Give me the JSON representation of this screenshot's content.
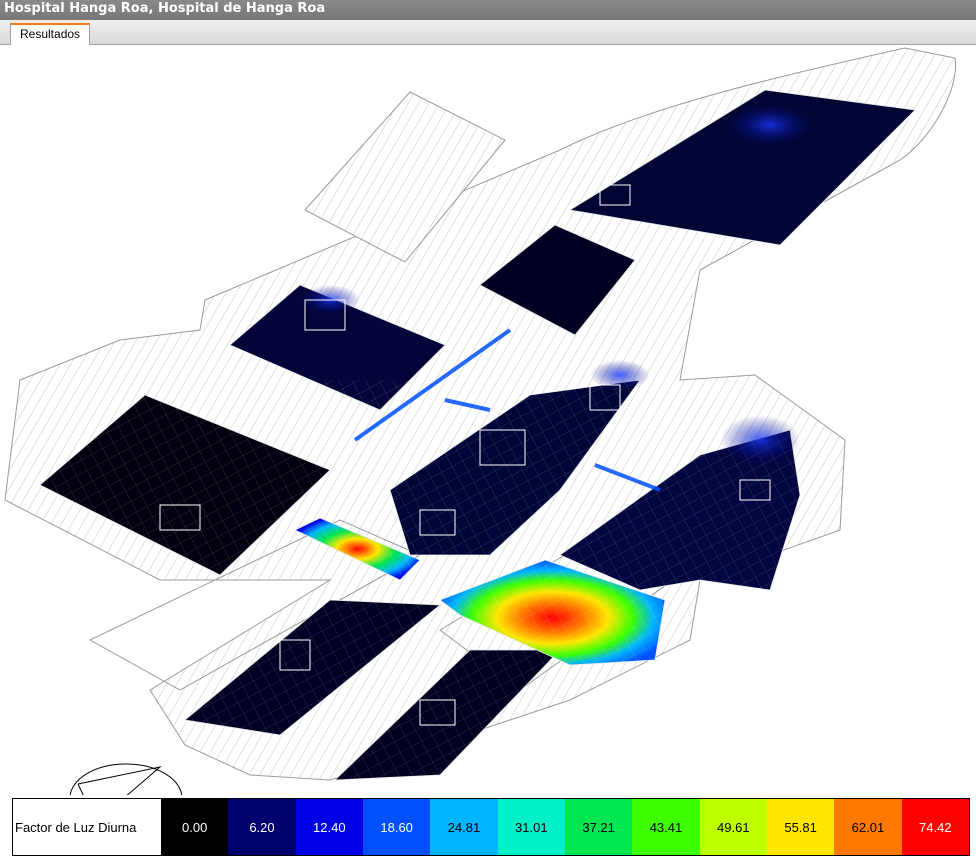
{
  "window": {
    "title": "Hospital Hanga Roa, Hospital de Hanga Roa"
  },
  "tabs": [
    {
      "label": "Resultados",
      "active": true
    }
  ],
  "legend": {
    "title": "Factor de Luz Diurna",
    "stops": [
      {
        "value": "0.00",
        "color": "#000000",
        "text_color": "#ffffff"
      },
      {
        "value": "6.20",
        "color": "#00006e",
        "text_color": "#ffffff"
      },
      {
        "value": "12.40",
        "color": "#0000e6",
        "text_color": "#ffffff"
      },
      {
        "value": "18.60",
        "color": "#0050ff",
        "text_color": "#ffffff"
      },
      {
        "value": "24.81",
        "color": "#00b4ff",
        "text_color": "#000000"
      },
      {
        "value": "31.01",
        "color": "#00f0c8",
        "text_color": "#000000"
      },
      {
        "value": "37.21",
        "color": "#00e650",
        "text_color": "#000000"
      },
      {
        "value": "43.41",
        "color": "#3cff00",
        "text_color": "#000000"
      },
      {
        "value": "49.61",
        "color": "#beff00",
        "text_color": "#000000"
      },
      {
        "value": "55.81",
        "color": "#ffe600",
        "text_color": "#000000"
      },
      {
        "value": "62.01",
        "color": "#ff7800",
        "text_color": "#000000"
      },
      {
        "value": "74.42",
        "color": "#ff0000",
        "text_color": "#ffffff"
      }
    ]
  }
}
